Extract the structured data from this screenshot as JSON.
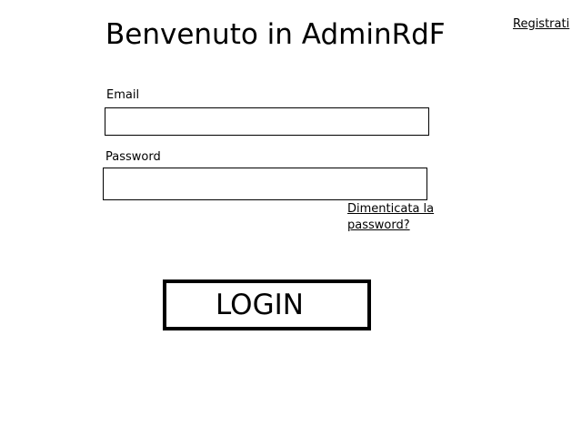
{
  "header": {
    "title": "Benvenuto in AdminRdF",
    "register_link": "Registrati"
  },
  "form": {
    "email_label": "Email",
    "email_value": "",
    "password_label": "Password",
    "password_value": "",
    "forgot_password_link": "Dimenticata la password?",
    "login_button": "LOGIN"
  }
}
